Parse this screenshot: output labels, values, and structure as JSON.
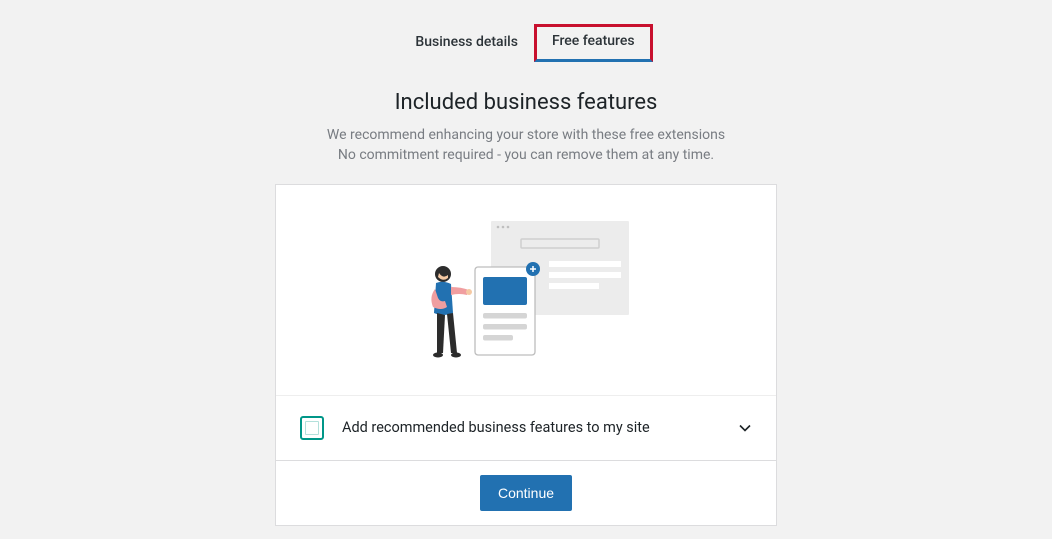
{
  "tabs": {
    "business_details": "Business details",
    "free_features": "Free features"
  },
  "heading": "Included business features",
  "subtext_line1": "We recommend enhancing your store with these free extensions",
  "subtext_line2": "No commitment required - you can remove them at any time.",
  "option": {
    "label": "Add recommended business features to my site"
  },
  "cta": {
    "continue": "Continue"
  },
  "colors": {
    "primary": "#2271b1",
    "highlight": "#c8102e",
    "teal": "#009688"
  }
}
